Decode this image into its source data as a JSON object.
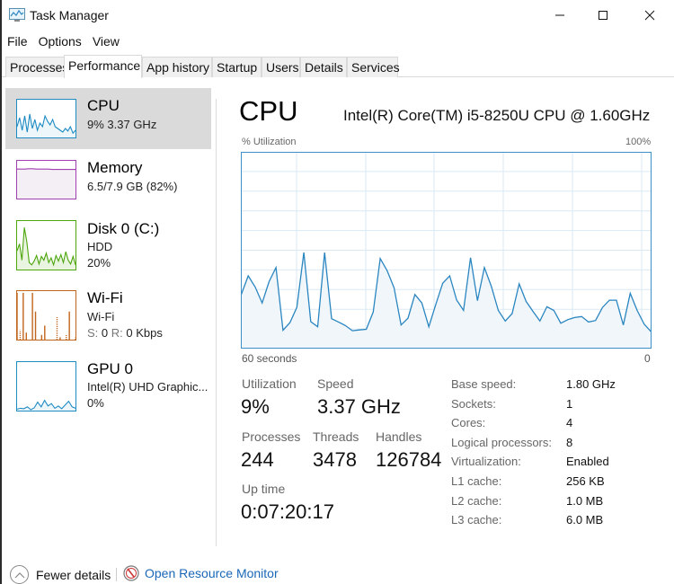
{
  "window": {
    "title": "Task Manager",
    "controls": {
      "minimize": "minimize",
      "maximize": "maximize",
      "close": "close"
    }
  },
  "menu": [
    "File",
    "Options",
    "View"
  ],
  "tabs": [
    {
      "label": "Processes",
      "active": false
    },
    {
      "label": "Performance",
      "active": true
    },
    {
      "label": "App history",
      "active": false
    },
    {
      "label": "Startup",
      "active": false
    },
    {
      "label": "Users",
      "active": false
    },
    {
      "label": "Details",
      "active": false
    },
    {
      "label": "Services",
      "active": false
    }
  ],
  "sidebar": {
    "items": [
      {
        "title": "CPU",
        "line1": "9%  3.37 GHz",
        "line2": "",
        "color": "#1e8bc3",
        "selected": true
      },
      {
        "title": "Memory",
        "line1": "6.5/7.9 GB (82%)",
        "line2": "",
        "color": "#a03fb0",
        "usage_fraction": 0.82
      },
      {
        "title": "Disk 0 (C:)",
        "line1": "HDD",
        "line2": "20%",
        "color": "#4da60c"
      },
      {
        "title": "Wi-Fi",
        "line1": "Wi-Fi",
        "line2_s_label": "S:",
        "line2_s_value": "0",
        "line2_r_label": "R:",
        "line2_r_value": "0 Kbps",
        "color": "#c1651c"
      },
      {
        "title": "GPU 0",
        "line1": "Intel(R) UHD Graphic...",
        "line2": "0%",
        "color": "#1e8bc3"
      }
    ]
  },
  "main": {
    "title": "CPU",
    "model": "Intel(R) Core(TM) i5-8250U CPU @ 1.60GHz",
    "graph_label": "% Utilization",
    "graph_max_label": "100%",
    "graph_time_label": "60 seconds",
    "graph_zero_label": "0",
    "stats": {
      "utilization": {
        "label": "Utilization",
        "value": "9%"
      },
      "speed": {
        "label": "Speed",
        "value": "3.37 GHz"
      },
      "processes": {
        "label": "Processes",
        "value": "244"
      },
      "threads": {
        "label": "Threads",
        "value": "3478"
      },
      "handles": {
        "label": "Handles",
        "value": "126784"
      },
      "uptime": {
        "label": "Up time",
        "value": "0:07:20:17"
      }
    },
    "specs": [
      {
        "label": "Base speed:",
        "value": "1.80 GHz"
      },
      {
        "label": "Sockets:",
        "value": "1"
      },
      {
        "label": "Cores:",
        "value": "4"
      },
      {
        "label": "Logical processors:",
        "value": "8"
      },
      {
        "label": "Virtualization:",
        "value": "Enabled"
      },
      {
        "label": "L1 cache:",
        "value": "256 KB"
      },
      {
        "label": "L2 cache:",
        "value": "1.0 MB"
      },
      {
        "label": "L3 cache:",
        "value": "6.0 MB"
      }
    ]
  },
  "footer": {
    "fewer_details": "Fewer details",
    "open_resource_monitor": "Open Resource Monitor"
  },
  "colors": {
    "cpu_line": "#2a86c0",
    "cpu_fill": "#f1f6fa",
    "grid": "#d9eaf5",
    "link": "#1a67b8",
    "selected_bg": "#dadada"
  },
  "chart_data": {
    "type": "area",
    "title": "% Utilization",
    "xlabel": "60 seconds",
    "x_range_labels": [
      "60 seconds",
      "0"
    ],
    "ylim": [
      0,
      100
    ],
    "y_max_label": "100%",
    "grid": true,
    "values": [
      27.5,
      37.0,
      31.3,
      23.2,
      34.0,
      41.2,
      9.3,
      13.2,
      20.9,
      48.8,
      13.7,
      11.1,
      48.8,
      15.2,
      13.5,
      11.7,
      9.1,
      9.5,
      9.8,
      18.6,
      45.8,
      39.6,
      30.9,
      12.0,
      15.5,
      27.5,
      23.2,
      11.1,
      22.4,
      33.2,
      37.0,
      24.7,
      19.4,
      46.2,
      24.4,
      41.2,
      31.7,
      19.4,
      14.0,
      17.8,
      32.9,
      24.0,
      18.9,
      14.0,
      21.3,
      19.4,
      12.9,
      14.7,
      15.8,
      16.3,
      13.5,
      14.3,
      20.9,
      24.6,
      24.6,
      12.0,
      28.1,
      19.4,
      12.4,
      8.6
    ]
  },
  "thumbnails": {
    "cpu": [
      30,
      55,
      20,
      60,
      15,
      65,
      25,
      50,
      20,
      40,
      30,
      60,
      45,
      35,
      50,
      30,
      25,
      20,
      15,
      25,
      18,
      30,
      12,
      20
    ],
    "memory": [
      82,
      82,
      82,
      83,
      83,
      82,
      82,
      82,
      82,
      81,
      81,
      81,
      81,
      81,
      81,
      81
    ],
    "disk": [
      40,
      55,
      20,
      90,
      60,
      15,
      10,
      18,
      30,
      12,
      28,
      20,
      35,
      15,
      25,
      10,
      30,
      18,
      32,
      15,
      38,
      20,
      12,
      28,
      10
    ],
    "wifi": [
      100,
      20,
      100,
      15,
      0,
      100,
      60,
      0,
      10,
      30,
      0,
      0,
      0,
      50,
      5,
      0,
      10,
      60,
      0,
      5
    ],
    "gpu": [
      3,
      5,
      4,
      8,
      2,
      6,
      18,
      8,
      22,
      10,
      15,
      5,
      10,
      4,
      12,
      20,
      8,
      5
    ]
  }
}
